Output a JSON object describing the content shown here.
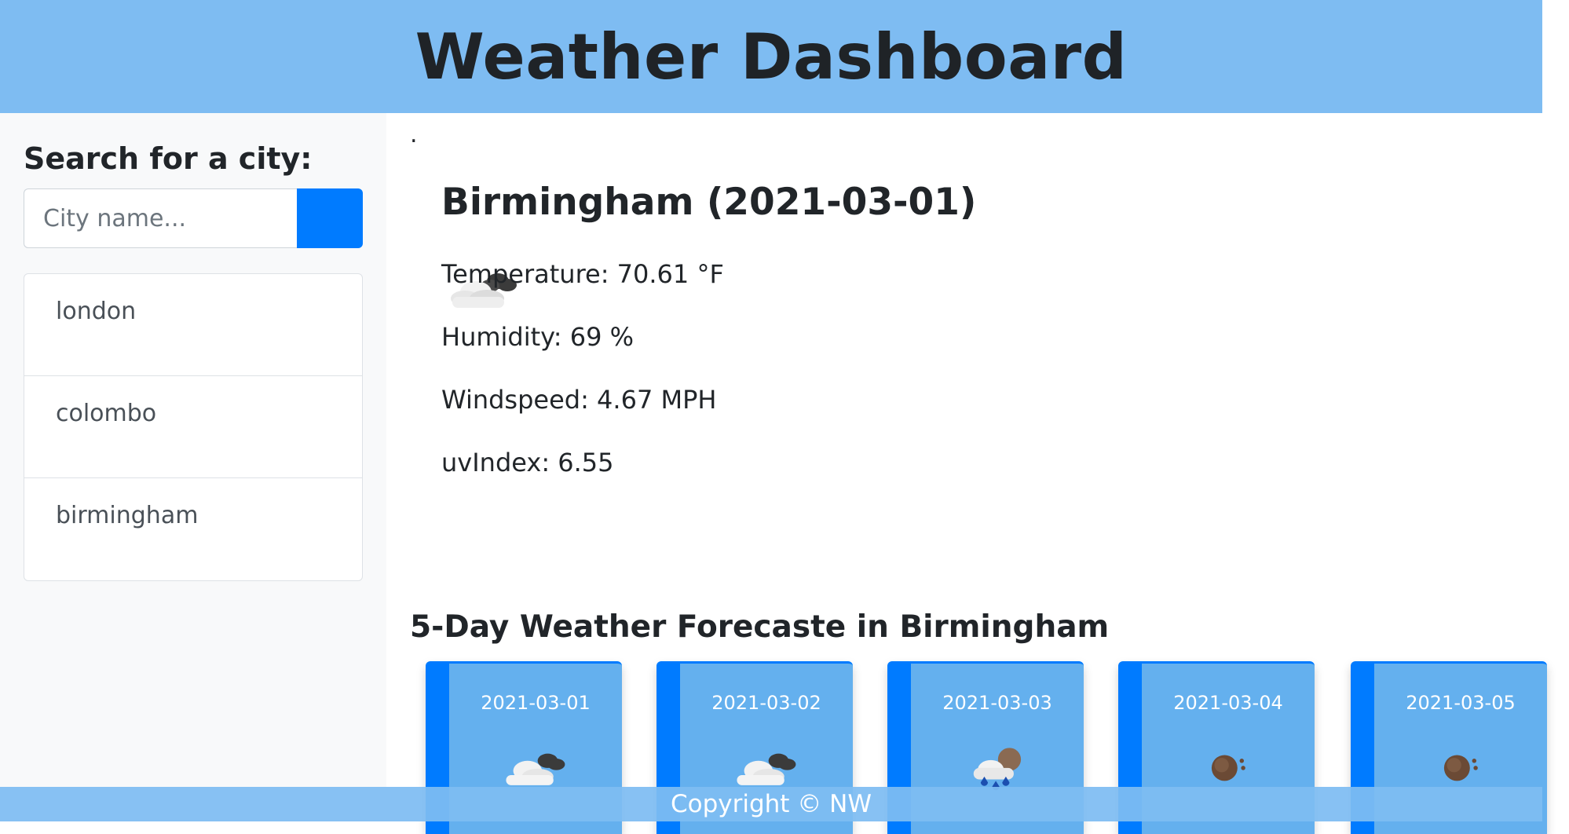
{
  "header": {
    "title": "Weather Dashboard"
  },
  "sidebar": {
    "search_label": "Search for a city:",
    "search_placeholder": "City name...",
    "cities": [
      "london",
      "colombo",
      "birmingham"
    ]
  },
  "current": {
    "dot": ".",
    "title": "Birmingham (2021-03-01)",
    "icon": "cloudy-icon",
    "temperature": "Temperature: 70.61 °F",
    "humidity": "Humidity: 69 %",
    "windspeed": "Windspeed: 4.67 MPH",
    "uv_index": "uvIndex: 6.55"
  },
  "forecast": {
    "title": "5-Day Weather Forecaste in Birmingham",
    "days": [
      {
        "date": "2021-03-01",
        "icon": "cloudy-icon"
      },
      {
        "date": "2021-03-02",
        "icon": "cloudy-icon"
      },
      {
        "date": "2021-03-03",
        "icon": "rain-icon"
      },
      {
        "date": "2021-03-04",
        "icon": "dust-icon"
      },
      {
        "date": "2021-03-05",
        "icon": "dust-icon"
      }
    ]
  },
  "footer": {
    "text": "Copyright © NW"
  },
  "colors": {
    "header_bg": "#7ebcf2",
    "accent": "#007bff",
    "card_bg": "#64b0ee"
  }
}
